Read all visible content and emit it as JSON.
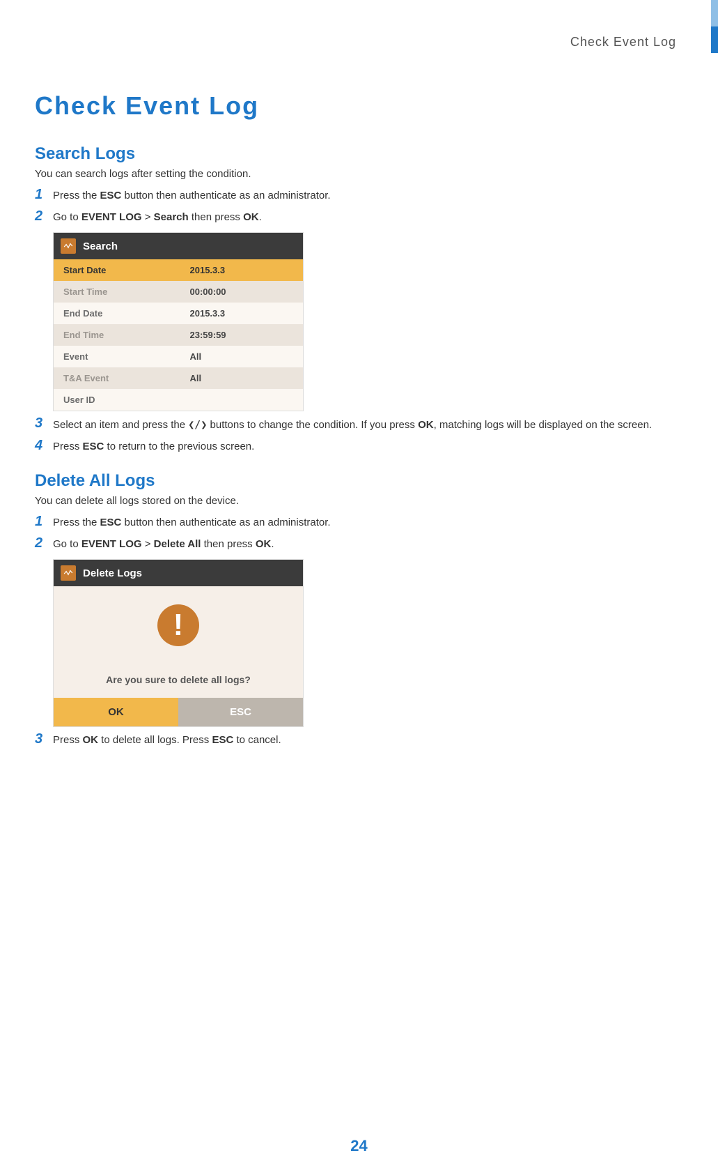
{
  "running_header": "Check Event Log",
  "page_title": "Check Event Log",
  "section_search": {
    "heading": "Search Logs",
    "intro": "You can search logs after setting the condition.",
    "steps": [
      {
        "num": "1",
        "pre": "Press the ",
        "b1": "ESC",
        "post": " button then authenticate as an administrator."
      },
      {
        "num": "2",
        "pre": "Go to ",
        "b1": "EVENT LOG",
        "sep": " > ",
        "b2": "Search",
        "mid": " then press ",
        "b3": "OK",
        "end": "."
      },
      {
        "num": "3",
        "pre": "Select an item and press the ",
        "arrows": "❮/❯",
        "mid": " buttons to change the condition. If you press ",
        "b1": "OK",
        "post": ", matching logs will be displayed on the screen."
      },
      {
        "num": "4",
        "pre": "Press ",
        "b1": "ESC",
        "post": " to return to the previous screen."
      }
    ],
    "screenshot": {
      "title": "Search",
      "rows": [
        {
          "label": "Start Date",
          "value": "2015.3.3",
          "style": "hl"
        },
        {
          "label": "Start Time",
          "value": "00:00:00",
          "style": "mute"
        },
        {
          "label": "End Date",
          "value": "2015.3.3",
          "style": "white"
        },
        {
          "label": "End Time",
          "value": "23:59:59",
          "style": "mute"
        },
        {
          "label": "Event",
          "value": "All",
          "style": "white"
        },
        {
          "label": "T&A Event",
          "value": "All",
          "style": "mute"
        },
        {
          "label": "User ID",
          "value": "",
          "style": "white"
        }
      ]
    }
  },
  "section_delete": {
    "heading": "Delete All Logs",
    "intro": "You can delete all logs stored on the device.",
    "steps": [
      {
        "num": "1",
        "pre": "Press the ",
        "b1": "ESC",
        "post": " button then authenticate as an administrator."
      },
      {
        "num": "2",
        "pre": "Go to ",
        "b1": "EVENT LOG",
        "sep": " > ",
        "b2": "Delete All",
        "mid": " then press ",
        "b3": "OK",
        "end": "."
      },
      {
        "num": "3",
        "pre": "Press ",
        "b1": "OK",
        "mid": " to delete all logs. Press ",
        "b2": "ESC",
        "post": " to cancel."
      }
    ],
    "dialog": {
      "title": "Delete Logs",
      "message": "Are you sure to delete all logs?",
      "ok": "OK",
      "esc": "ESC"
    }
  },
  "page_number": "24"
}
